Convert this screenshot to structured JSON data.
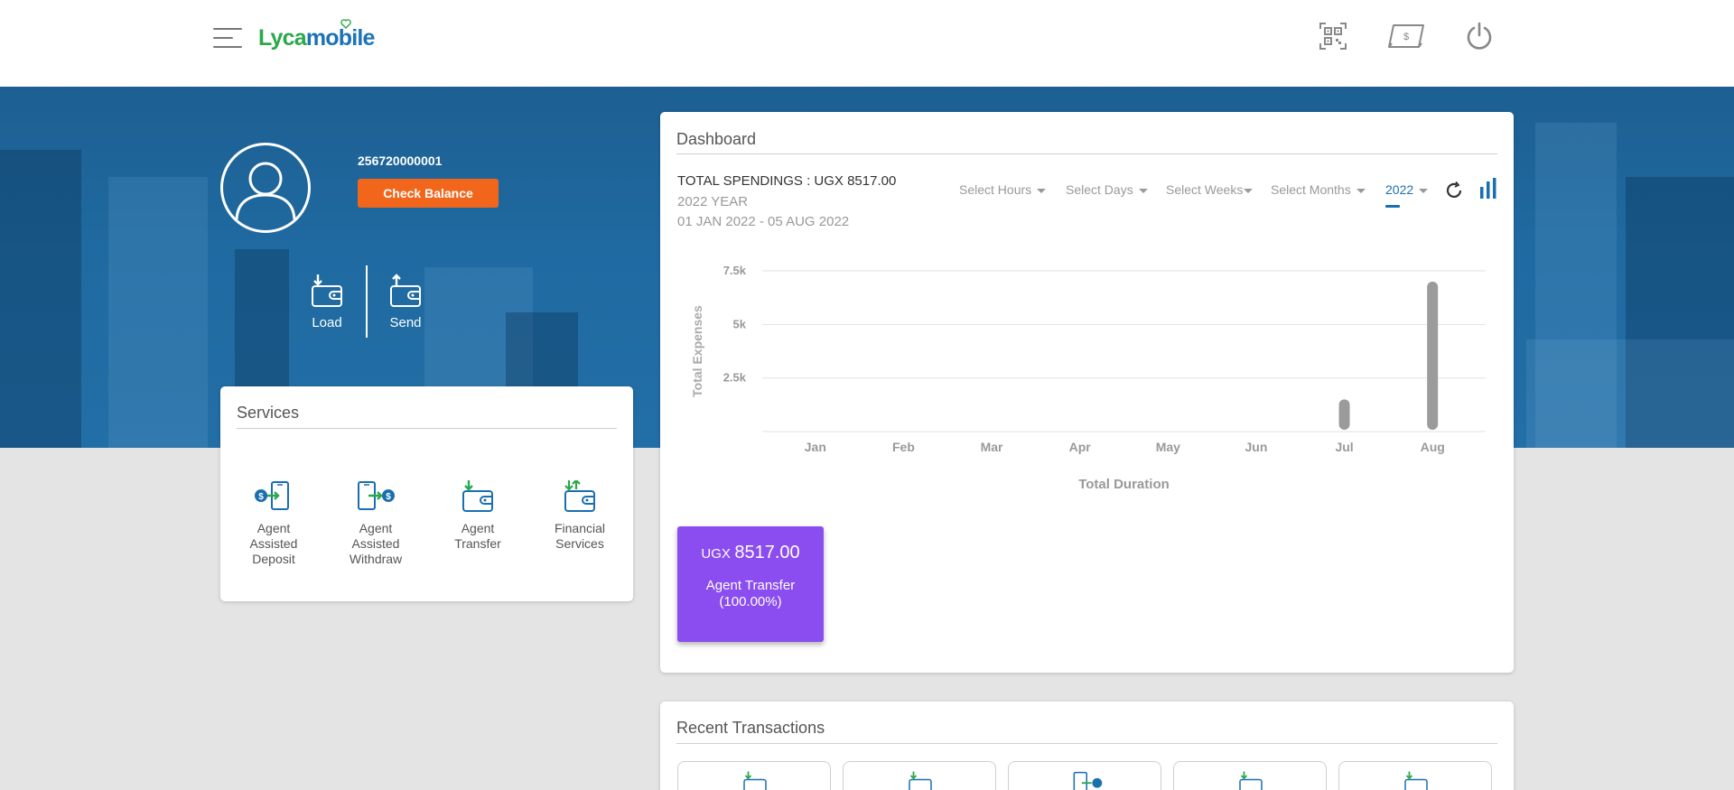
{
  "brand": {
    "logo_part1": "Lyca",
    "logo_part2": "mobile"
  },
  "profile": {
    "msisdn": "256720000001",
    "check_balance_label": "Check Balance"
  },
  "wallet_actions": {
    "load_label": "Load",
    "send_label": "Send"
  },
  "services": {
    "title": "Services",
    "items": [
      {
        "label": "Agent Assisted Deposit"
      },
      {
        "label": "Agent Assisted Withdraw"
      },
      {
        "label": "Agent Transfer"
      },
      {
        "label": "Financial Services"
      }
    ]
  },
  "dashboard": {
    "title": "Dashboard",
    "total_spendings": "TOTAL SPENDINGS : UGX 8517.00",
    "period_year": "2022 YEAR",
    "period_range": "01 JAN 2022 - 05 AUG 2022",
    "filters": {
      "hours": "Select Hours",
      "days": "Select Days",
      "weeks": "Select Weeks",
      "months": "Select Months",
      "year": "2022"
    },
    "summary": {
      "currency": "UGX",
      "amount": "8517.00",
      "label": "Agent Transfer",
      "percent": "(100.00%)"
    }
  },
  "chart_data": {
    "type": "bar",
    "categories": [
      "Jan",
      "Feb",
      "Mar",
      "Apr",
      "May",
      "Jun",
      "Jul",
      "Aug"
    ],
    "values": [
      0,
      0,
      0,
      0,
      0,
      0,
      1500,
      7000
    ],
    "ylabel": "Total Expenses",
    "xlabel": "Total Duration",
    "yticks": [
      {
        "value": 2500,
        "label": "2.5k"
      },
      {
        "value": 5000,
        "label": "5k"
      },
      {
        "value": 7500,
        "label": "7.5k"
      }
    ],
    "ylim": [
      0,
      7500
    ],
    "grid": true,
    "bar_color": "#9b9b9b"
  },
  "recent": {
    "title": "Recent Transactions"
  },
  "colors": {
    "accent": "#1a6fb0",
    "orange": "#f2661c",
    "purple": "#8b4df0",
    "green": "#2aa84a"
  }
}
